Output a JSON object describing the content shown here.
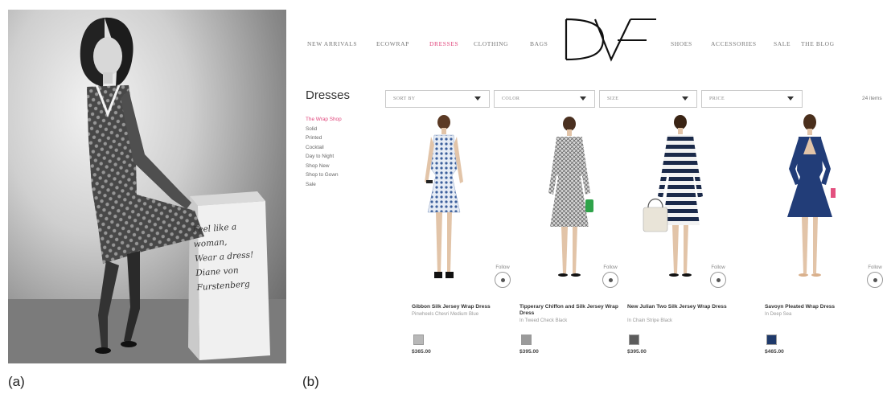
{
  "captions": {
    "a": "(a)",
    "b": "(b)"
  },
  "photo": {
    "handwriting_lines": [
      "Feel like a",
      "woman,",
      "Wear a dress!",
      "Diane von Furstenberg"
    ]
  },
  "website": {
    "nav_left": [
      "NEW ARRIVALS",
      "ECOWRAP",
      "DRESSES",
      "CLOTHING",
      "BAGS"
    ],
    "logo_text": "DVF",
    "nav_right": [
      "SHOES",
      "ACCESSORIES",
      "SALE",
      "THE BLOG"
    ],
    "active_nav": "DRESSES",
    "page_title": "Dresses",
    "sidebar_items": [
      "The Wrap Shop",
      "Solid",
      "Printed",
      "Cocktail",
      "Day to Night",
      "Shop New",
      "Shop to Gown",
      "Sale"
    ],
    "filters": [
      "SORT BY",
      "COLOR",
      "SIZE",
      "PRICE"
    ],
    "item_count": "24 items",
    "follow_label": "Follow",
    "products": [
      {
        "name": "Gibbon Silk Jersey Wrap Dress",
        "color": "Pinwheels Chevri Medium Blue",
        "price": "$365.00",
        "swatch": "#b8b8b8"
      },
      {
        "name": "Tipperary Chiffon and Silk Jersey Wrap Dress",
        "color": "In Tweed Check Black",
        "price": "$395.00",
        "swatch": "#9a9a9a"
      },
      {
        "name": "New Julian Two Silk Jersey Wrap Dress",
        "color": "In Chain Stripe Black",
        "price": "$395.00",
        "swatch": "#5c5c5c"
      },
      {
        "name": "Savoyn Pleated Wrap Dress",
        "color": "In Deep Sea",
        "price": "$465.00",
        "swatch": "#1f3a6b"
      }
    ]
  },
  "colors": {
    "accent": "#e0457b",
    "navy": "#223d78",
    "text": "#222222"
  }
}
